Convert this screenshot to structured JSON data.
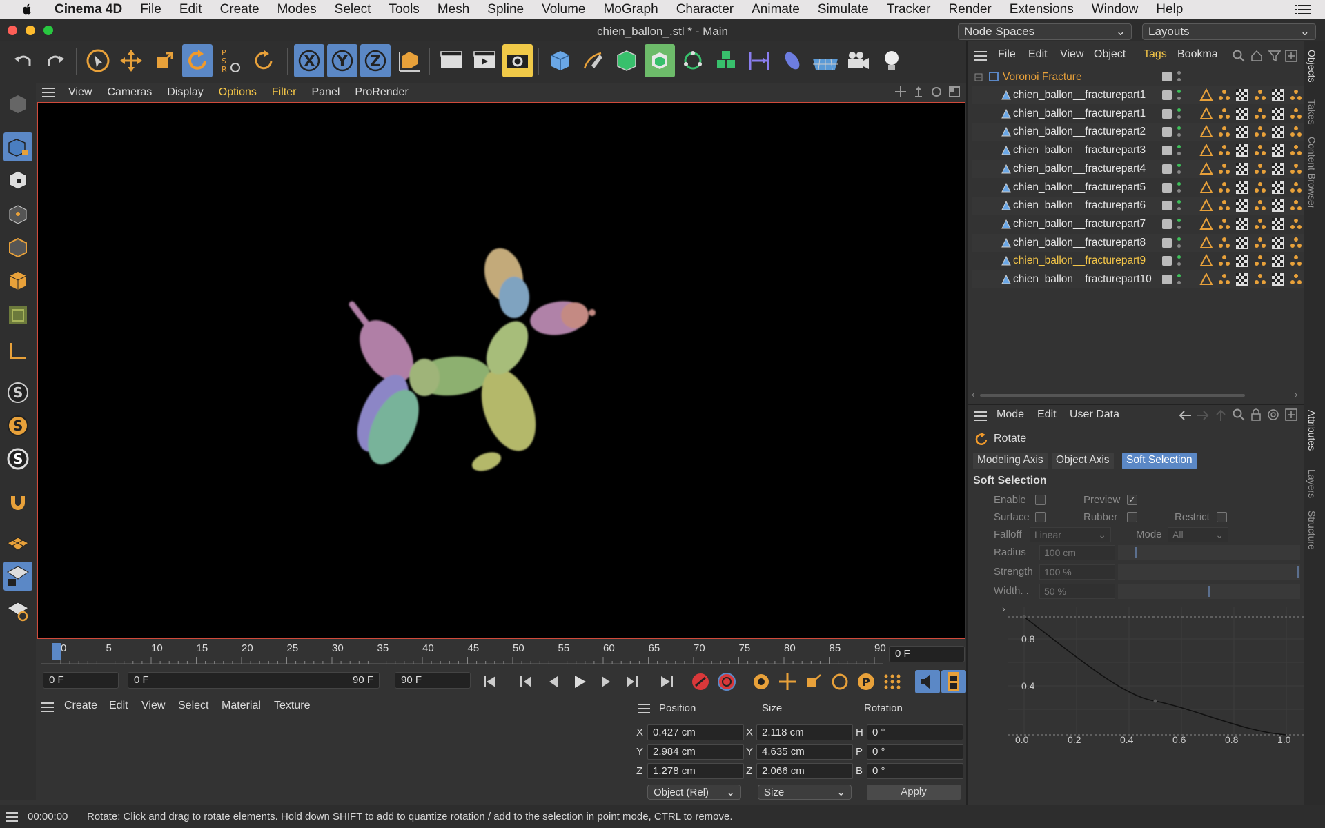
{
  "menubar": {
    "app": "Cinema 4D",
    "items": [
      "File",
      "Edit",
      "Create",
      "Modes",
      "Select",
      "Tools",
      "Mesh",
      "Spline",
      "Volume",
      "MoGraph",
      "Character",
      "Animate",
      "Simulate",
      "Tracker",
      "Render",
      "Extensions",
      "Window",
      "Help"
    ]
  },
  "window": {
    "title": "chien_ballon_.stl * - Main",
    "node_spaces": "Node Spaces",
    "layouts": "Layouts"
  },
  "viewport_menu": [
    "View",
    "Cameras",
    "Display",
    "Options",
    "Filter",
    "Panel",
    "ProRender"
  ],
  "timeline": {
    "ticks": [
      "0",
      "5",
      "10",
      "15",
      "20",
      "25",
      "30",
      "35",
      "40",
      "45",
      "50",
      "55",
      "60",
      "65",
      "70",
      "75",
      "80",
      "85",
      "90"
    ],
    "current_frame": "0 F"
  },
  "transport": {
    "start": "0 F",
    "range_start": "0 F",
    "range_end": "90 F",
    "end": "90 F"
  },
  "material_menu": [
    "Create",
    "Edit",
    "View",
    "Select",
    "Material",
    "Texture"
  ],
  "coords": {
    "headers": [
      "Position",
      "Size",
      "Rotation"
    ],
    "rows": [
      {
        "axis": "X",
        "pos": "0.427 cm",
        "saxis": "X",
        "size": "2.118 cm",
        "raxis": "H",
        "rot": "0 °"
      },
      {
        "axis": "Y",
        "pos": "2.984 cm",
        "saxis": "Y",
        "size": "4.635 cm",
        "raxis": "P",
        "rot": "0 °"
      },
      {
        "axis": "Z",
        "pos": "1.278 cm",
        "saxis": "Z",
        "size": "2.066 cm",
        "raxis": "B",
        "rot": "0 °"
      }
    ],
    "mode": "Object (Rel)",
    "size_mode": "Size",
    "apply": "Apply"
  },
  "status": {
    "time": "00:00:00",
    "message": "Rotate: Click and drag to rotate elements. Hold down SHIFT to add to quantize rotation / add to the selection in point mode, CTRL to remove."
  },
  "object_manager": {
    "menu": [
      "File",
      "Edit",
      "View",
      "Object",
      "Tags",
      "Bookma"
    ],
    "active_menu": "Tags",
    "root": "Voronoi Fracture",
    "objects": [
      "chien_ballon__fracturepart1",
      "chien_ballon__fracturepart1",
      "chien_ballon__fracturepart2",
      "chien_ballon__fracturepart3",
      "chien_ballon__fracturepart4",
      "chien_ballon__fracturepart5",
      "chien_ballon__fracturepart6",
      "chien_ballon__fracturepart7",
      "chien_ballon__fracturepart8",
      "chien_ballon__fracturepart9",
      "chien_ballon__fracturepart10"
    ],
    "selected_index": 9
  },
  "attributes": {
    "menu": [
      "Mode",
      "Edit",
      "User Data"
    ],
    "tool": "Rotate",
    "tabs": [
      "Modeling Axis",
      "Object Axis",
      "Soft Selection"
    ],
    "active_tab": "Soft Selection",
    "section": "Soft Selection",
    "enable": "Enable",
    "preview": "Preview",
    "surface": "Surface",
    "rubber": "Rubber",
    "restrict": "Restrict",
    "falloff_label": "Falloff",
    "falloff": "Linear",
    "mode_label": "Mode",
    "mode": "All",
    "radius_label": "Radius",
    "radius": "100 cm",
    "strength_label": "Strength",
    "strength": "100 %",
    "width_label": "Width. .",
    "width": "50 %",
    "graph_x": [
      "0.0",
      "0.2",
      "0.4",
      "0.6",
      "0.8",
      "1.0"
    ],
    "graph_y": [
      "0.8",
      "0.4"
    ]
  },
  "side_tabs": [
    "Objects",
    "Takes",
    "Content Browser",
    "Attributes",
    "Layers",
    "Structure"
  ],
  "colors": {
    "accent": "#5b88c6",
    "highlight": "#f3c548",
    "viewport_border": "#d04a3b",
    "panel": "#333333"
  }
}
